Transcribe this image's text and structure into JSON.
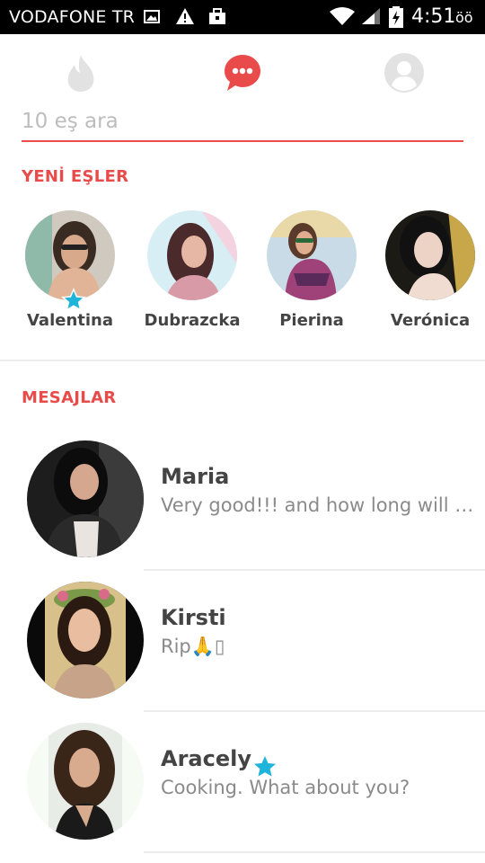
{
  "status_bar": {
    "carrier": "VODAFONE TR",
    "time": "4:51",
    "ampm": "öö",
    "icons": [
      "image-icon",
      "warning-icon",
      "briefcase-icon",
      "wifi-icon",
      "signal-icon",
      "battery-charging-icon"
    ]
  },
  "nav": {
    "tabs": [
      {
        "icon": "flame-icon",
        "active": false
      },
      {
        "icon": "chat-bubble-icon",
        "active": true
      },
      {
        "icon": "profile-icon",
        "active": false
      }
    ]
  },
  "search": {
    "placeholder": "10 eş ara",
    "value": ""
  },
  "new_matches": {
    "title": "YENİ EŞLER",
    "items": [
      {
        "name": "Valentina",
        "super_like": true
      },
      {
        "name": "Dubrazcka",
        "super_like": false
      },
      {
        "name": "Pierina",
        "super_like": false
      },
      {
        "name": "Verónica",
        "super_like": false
      }
    ]
  },
  "messages": {
    "title": "MESAJLAR",
    "items": [
      {
        "name": "Maria",
        "preview": "Very good!!! and how long will you be in",
        "super_like": false
      },
      {
        "name": "Kirsti",
        "preview": "Rip🙏▯",
        "super_like": false
      },
      {
        "name": "Aracely",
        "preview": "Cooking. What about you?",
        "super_like": true
      }
    ]
  },
  "colors": {
    "accent": "#e94b4b",
    "inactive_icon": "#e2e2e2",
    "super_like": "#1fb4d9",
    "text_dark": "#444444",
    "text_muted": "#8a8a8a"
  }
}
